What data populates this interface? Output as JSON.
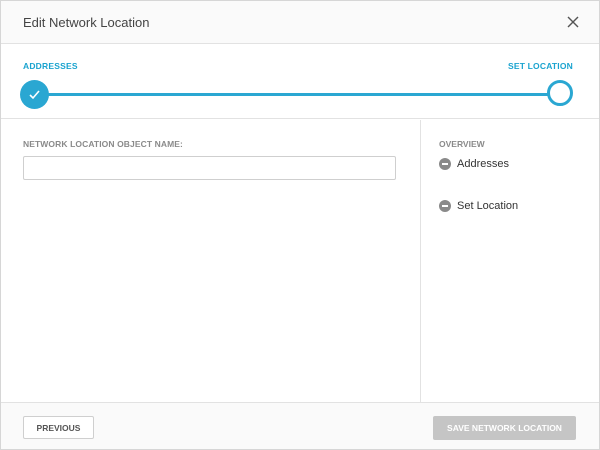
{
  "dialog": {
    "title": "Edit Network Location",
    "close_icon": "close-icon"
  },
  "stepper": {
    "steps": [
      {
        "label": "ADDRESSES",
        "state": "completed"
      },
      {
        "label": "SET LOCATION",
        "state": "current"
      }
    ],
    "accent_color": "#2aa7d2"
  },
  "form": {
    "name_label": "NETWORK LOCATION OBJECT NAME:",
    "name_value": "",
    "name_placeholder": ""
  },
  "overview": {
    "title": "OVERVIEW",
    "items": [
      {
        "label": "Addresses",
        "icon": "minus-circle-icon"
      },
      {
        "label": "Set Location",
        "icon": "minus-circle-icon"
      }
    ]
  },
  "footer": {
    "previous_label": "PREVIOUS",
    "save_label": "SAVE NETWORK LOCATION",
    "save_disabled_color": "#c5c5c5"
  }
}
